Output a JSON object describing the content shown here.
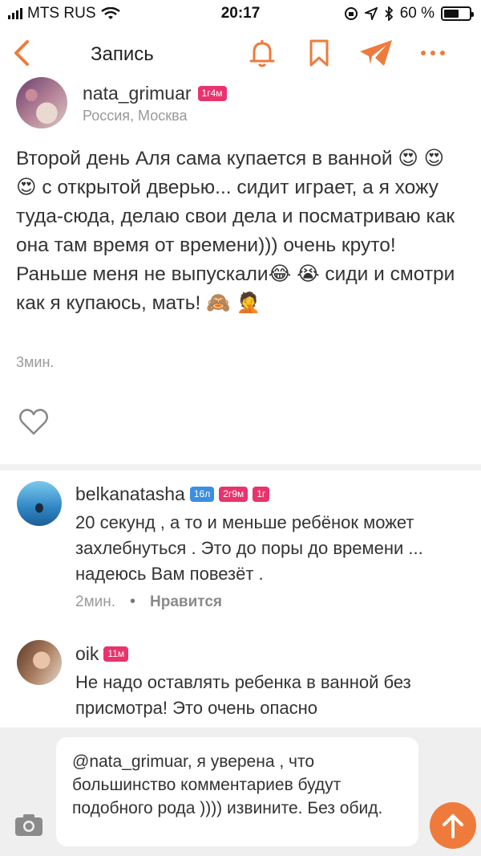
{
  "status_bar": {
    "carrier": "MTS RUS",
    "time": "20:17",
    "battery_percent_label": "60 %",
    "battery_level": 0.6
  },
  "nav": {
    "title": "Запись",
    "accent_color": "#ee7b3c",
    "icons": [
      "back-arrow-icon",
      "bell-icon",
      "bookmark-icon",
      "send-plane-icon",
      "more-dots-icon"
    ]
  },
  "post": {
    "username": "nata_grimuar",
    "badge": "1г4м",
    "location": "Россия, Москва",
    "text_parts": [
      "Второй день Аля сама купается в ванной ",
      "😍 😍 😍",
      " с открытой дверью... сидит играет, а я хожу туда-сюда, делаю свои дела и посматриваю как она там время от времени))) очень круто! Раньше меня не выпускали",
      "😂 😭",
      " сиди и смотри как я купаюсь, мать! ",
      "🙈 🤦"
    ],
    "time": "3мин."
  },
  "comments": [
    {
      "username": "belkanatasha",
      "badges": [
        {
          "text": "16л",
          "color": "blue"
        },
        {
          "text": "2г9м",
          "color": "pink"
        },
        {
          "text": "1г",
          "color": "pink"
        }
      ],
      "text": "20 секунд , а то и меньше ребёнок может захлебнуться . Это до поры до времени ... надеюсь Вам повезёт .",
      "time": "2мин.",
      "like_label": "Нравится"
    },
    {
      "username": "oik",
      "badges": [
        {
          "text": "11м",
          "color": "pink"
        }
      ],
      "text": "Не надо оставлять ребенка в ванной без присмотра! Это очень опасно"
    }
  ],
  "input": {
    "value": "@nata_grimuar, я уверена , что большинство комментариев будут подобного рода )))) извините. Без обид."
  }
}
